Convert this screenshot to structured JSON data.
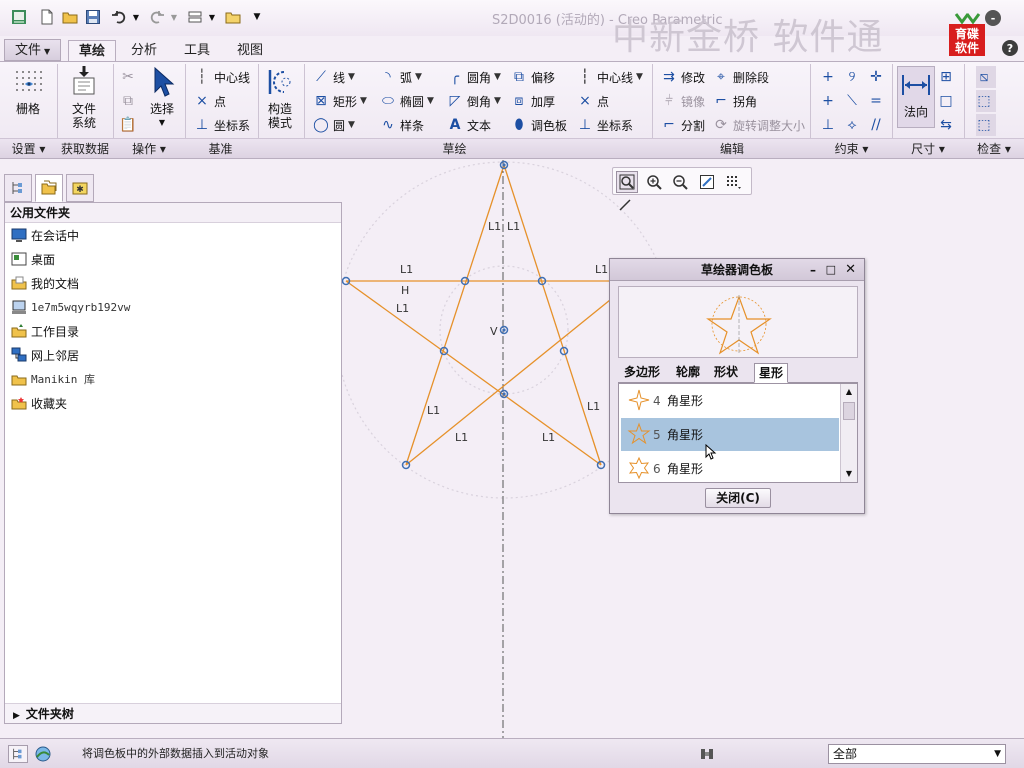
{
  "app": {
    "title": "S2D0016 (活动的) - Creo Parametric",
    "watermark": "中新金桥  软件通",
    "logo_text": "育碟软件"
  },
  "tabs": [
    "文件",
    "草绘",
    "分析",
    "工具",
    "视图"
  ],
  "active_tab": "草绘",
  "ribbon": {
    "groups": {
      "settings": "设置",
      "get_data": "获取数据",
      "operations": "操作",
      "datum": "基准",
      "sketch": "草绘",
      "edit": "编辑",
      "constrain": "约束",
      "dimension": "尺寸",
      "inspect": "检查"
    },
    "grid": "栅格",
    "file_system": [
      "文件",
      "系统"
    ],
    "select": "选择",
    "construction_mode": [
      "构造",
      "模式"
    ],
    "datum_centerline": "中心线",
    "datum_point": "点",
    "datum_csys": "坐标系",
    "line": "线",
    "rectangle": "矩形",
    "circle": "圆",
    "arc": "弧",
    "ellipse": "椭圆",
    "spline": "样条",
    "fillet": "圆角",
    "chamfer": "倒角",
    "text": "文本",
    "offset": "偏移",
    "thicken": "加厚",
    "palette": "调色板",
    "centerline": "中心线",
    "point": "点",
    "csys": "坐标系",
    "modify": "修改",
    "delete_segment": "删除段",
    "mirror": "镜像",
    "corner": "拐角",
    "divide": "分割",
    "rotate_resize": "旋转调整大小",
    "normal": "法向"
  },
  "left_panel": {
    "header": "公用文件夹",
    "folders": [
      "在会话中",
      "桌面",
      "我的文档",
      "1e7m5wqyrb192vw",
      "工作目录",
      "网上邻居",
      "Manikin 库",
      "收藏夹"
    ],
    "folder_tree": "文件夹树"
  },
  "sketch": {
    "labels": [
      "L1",
      "L1",
      "L1",
      "L1",
      "H",
      "L1",
      "V",
      "L1",
      "L1",
      "L1",
      "L1"
    ]
  },
  "palette": {
    "title": "草绘器调色板",
    "tabs": [
      "多边形",
      "轮廓",
      "形状",
      "星形"
    ],
    "active_tab": "星形",
    "items": [
      {
        "num": "4",
        "label": "角星形"
      },
      {
        "num": "5",
        "label": "角星形"
      },
      {
        "num": "6",
        "label": "角星形"
      }
    ],
    "selected_index": 1,
    "close": "关闭(C)"
  },
  "status": {
    "message": "将调色板中的外部数据插入到活动对象",
    "filter": "全部"
  },
  "colors": {
    "sketch": "#e6912a",
    "vertex": "#3f6fb3",
    "selection": "#a8c4de"
  }
}
